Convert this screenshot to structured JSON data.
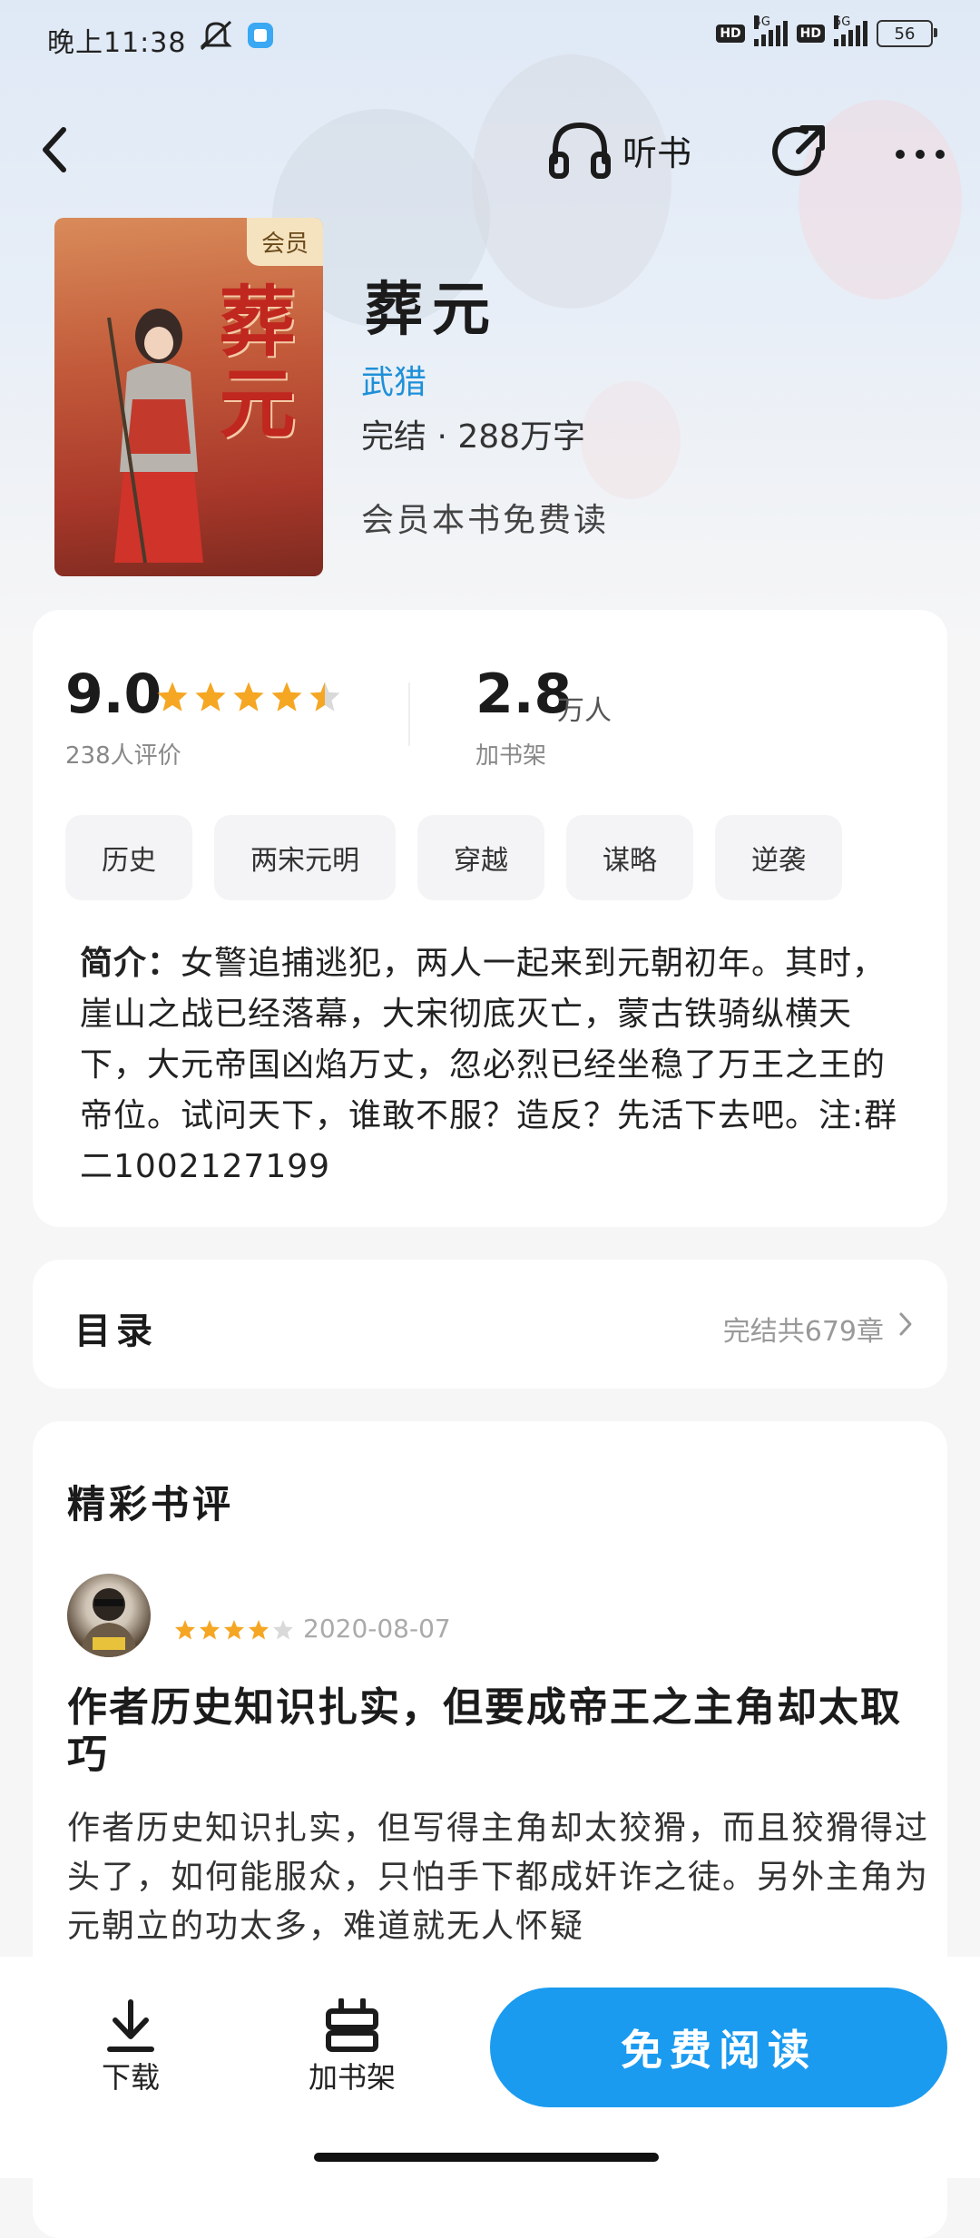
{
  "status_bar": {
    "time": "晚上11:38",
    "network_1": "4G",
    "network_2": "5G",
    "hd_label": "HD",
    "battery": "56"
  },
  "nav": {
    "listen_label": "听书"
  },
  "book": {
    "vip_tag": "会员",
    "title": "葬元",
    "author": "武猎",
    "status": "完结 · 288万字",
    "vip_note": "会员本书免费读"
  },
  "stats": {
    "rating": "9.0",
    "rating_stars": 4.5,
    "rating_count": "238人评价",
    "shelf_count": "2.8",
    "shelf_unit": "万人",
    "shelf_label": "加书架"
  },
  "tags": [
    "历史",
    "两宋元明",
    "穿越",
    "谋略",
    "逆袭"
  ],
  "intro": {
    "label": "简介：",
    "text": "女警追捕逃犯，两人一起来到元朝初年。其时，崖山之战已经落幕，大宋彻底灭亡，蒙古铁骑纵横天下，大元帝国凶焰万丈，忽必烈已经坐稳了万王之王的帝位。试问天下，谁敢不服？造反？先活下去吧。注:群二1002127199"
  },
  "toc": {
    "label": "目录",
    "meta": "完结共679章"
  },
  "reviews": {
    "section_title": "精彩书评",
    "items": [
      {
        "stars": 4,
        "date": "2020-08-07",
        "title": "作者历史知识扎实，但要成帝王之主角却太取巧",
        "body": "作者历史知识扎实，但写得主角却太狡猾，而且狡猾得过头了，如何能服众，只怕手下都成奸诈之徒。另外主角为元朝立的功太多，难道就无人怀疑"
      }
    ]
  },
  "bottom_bar": {
    "download_label": "下载",
    "shelf_label": "加书架",
    "read_label": "免费阅读"
  },
  "colors": {
    "accent": "#1a9bf0",
    "author_link": "#1f90d8",
    "star": "#f5a623",
    "vip_tag_bg": "#f5e3c0"
  }
}
